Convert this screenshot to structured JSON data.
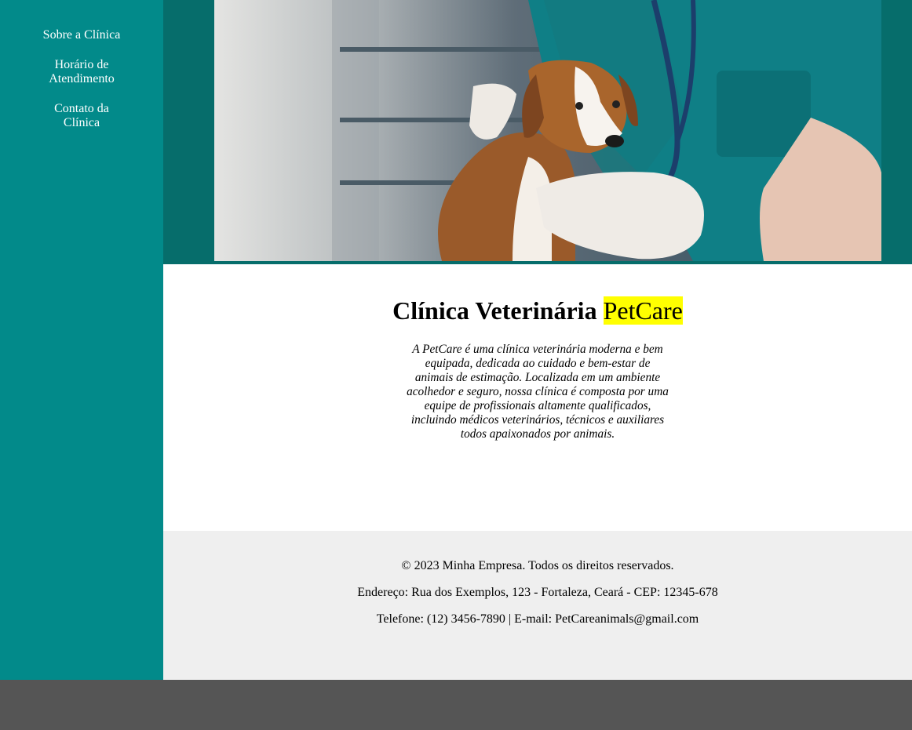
{
  "nav": {
    "items": [
      {
        "label": "Sobre a Clínica"
      },
      {
        "label": "Horário de Atendimento"
      },
      {
        "label": "Contato da Clínica"
      }
    ]
  },
  "hero": {
    "image": "veterinarian-examining-puppy-photo"
  },
  "main": {
    "title_prefix": "Clínica Veterinária",
    "title_highlight": "PetCare",
    "description": "A PetCare é uma clínica veterinária moderna e bem equipada, dedicada ao cuidado e bem-estar de animais de estimação. Localizada em um ambiente acolhedor e seguro, nossa clínica é composta por uma equipe de profissionais altamente qualificados, incluindo médicos veterinários, técnicos e auxiliares todos apaixonados por animais."
  },
  "footer": {
    "copyright": "© 2023 Minha Empresa. Todos os direitos reservados.",
    "address": "Endereço: Rua dos Exemplos, 123 - Fortaleza, Ceará - CEP: 12345-678",
    "contact": "Telefone: (12) 3456-7890 | E-mail: PetCareanimals@gmail.com"
  },
  "colors": {
    "sidebar": "#028a8a",
    "hero_background": "#066d6b",
    "highlight": "#ffff00",
    "footer_background": "#efefef",
    "page_background": "#555555"
  }
}
